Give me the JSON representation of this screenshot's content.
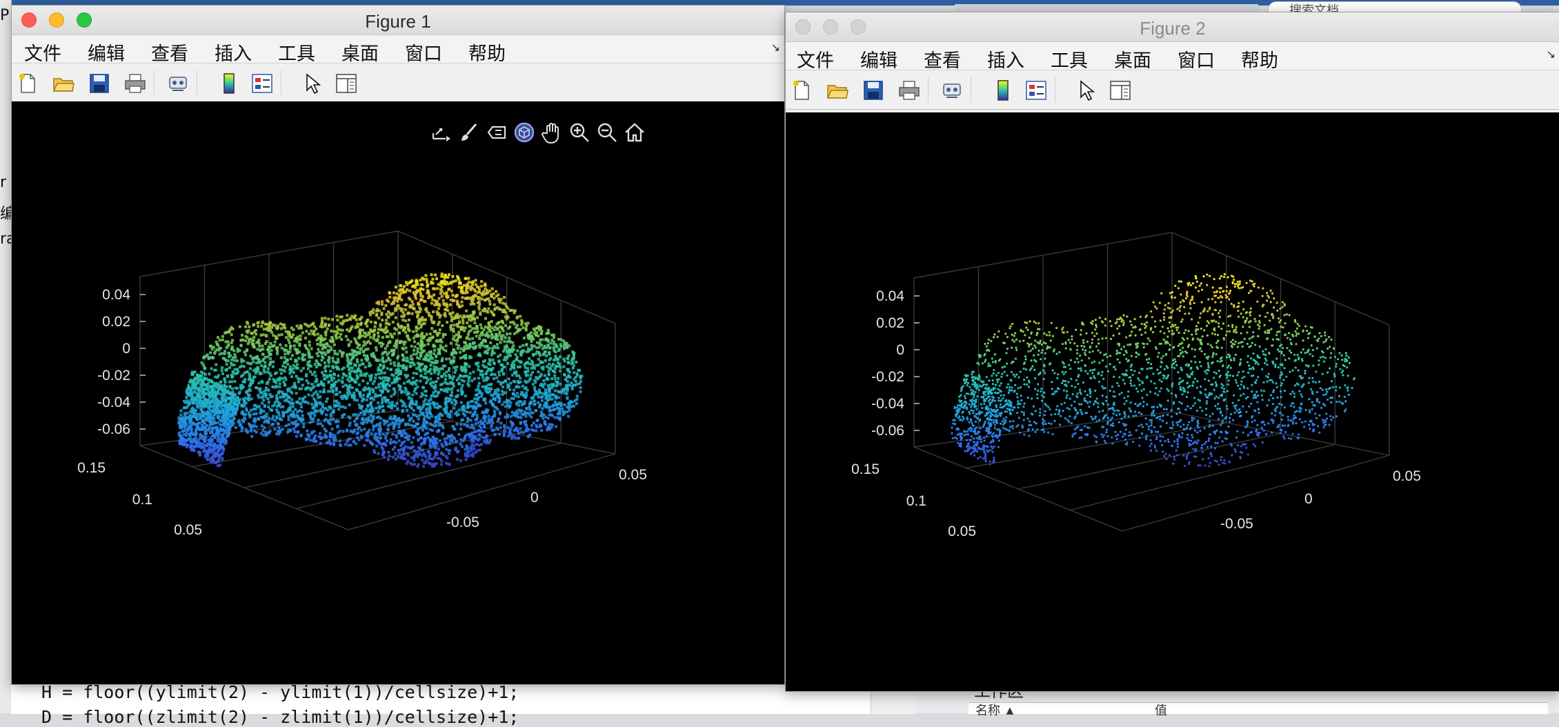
{
  "background": {
    "code_lines": [
      "H = floor((ylimit(2) - ylimit(1))/cellsize)+1;",
      "D = floor((zlimit(2) - zlimit(1))/cellsize)+1;"
    ],
    "left_letters": [
      "P",
      "r",
      "编",
      "ra"
    ],
    "workspace_label": "工作区",
    "workspace_columns": [
      "名称 ▲",
      "值"
    ],
    "search_placeholder": "搜索文档"
  },
  "figures": [
    {
      "title": "Figure 1",
      "menu": [
        "文件",
        "编辑",
        "查看",
        "插入",
        "工具",
        "桌面",
        "窗口",
        "帮助"
      ],
      "axes_toolbar": [
        "export-icon",
        "brush-icon",
        "datatip-icon",
        "rotate-icon",
        "pan-icon",
        "zoom-in-icon",
        "zoom-out-icon",
        "home-icon"
      ],
      "ztick_labels": [
        "0.04",
        "0.02",
        "0",
        "-0.02",
        "-0.04",
        "-0.06"
      ],
      "y_tick_labels": [
        "0.15",
        "0.1",
        "0.05"
      ],
      "x_tick_labels": [
        "0.05",
        "0",
        "-0.05"
      ],
      "style": "dense-surface"
    },
    {
      "title": "Figure 2",
      "menu": [
        "文件",
        "编辑",
        "查看",
        "插入",
        "工具",
        "桌面",
        "窗口",
        "帮助"
      ],
      "ztick_labels": [
        "0.04",
        "0.02",
        "0",
        "-0.02",
        "-0.04",
        "-0.06"
      ],
      "y_tick_labels": [
        "0.15",
        "0.1",
        "0.05"
      ],
      "x_tick_labels": [
        "0.05",
        "0",
        "-0.05"
      ],
      "style": "sparse-points"
    }
  ],
  "toolbar_icons": [
    "new-file-icon",
    "open-folder-icon",
    "save-icon",
    "print-icon",
    "link-icon",
    "colorbar-icon",
    "legend-icon",
    "pointer-icon",
    "property-editor-icon"
  ],
  "colors": {
    "plot_bg": "#000000",
    "colormap": [
      "#3e26a8",
      "#2f6ff0",
      "#1fa8d8",
      "#2cc6a6",
      "#8ccc4d",
      "#e0c22f",
      "#f9fb0e"
    ]
  }
}
